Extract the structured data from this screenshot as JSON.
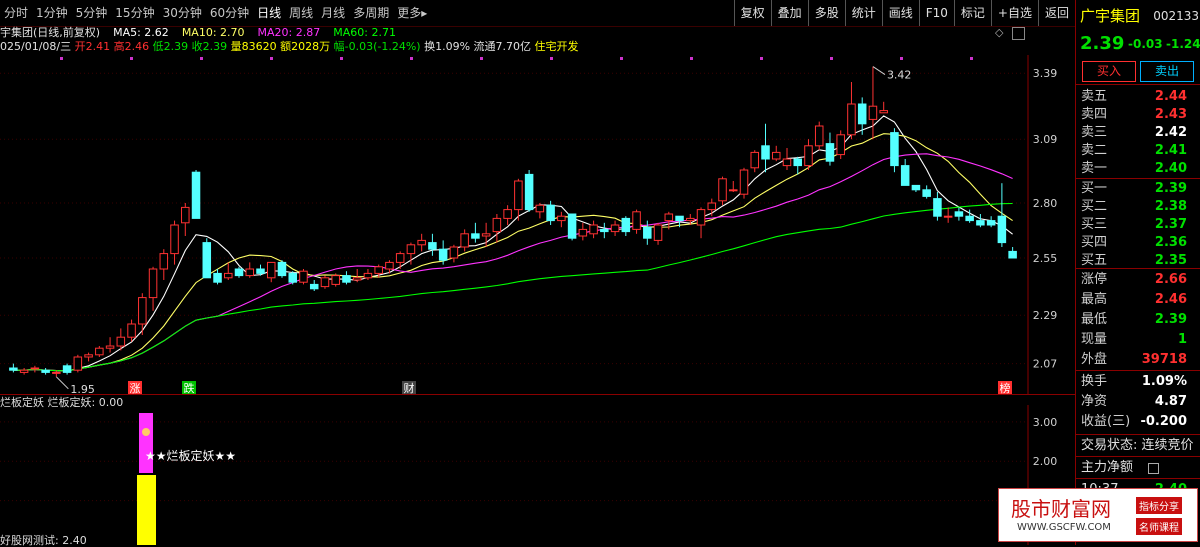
{
  "toolbar": {
    "periods": [
      "分时",
      "1分钟",
      "5分钟",
      "15分钟",
      "30分钟",
      "60分钟",
      "日线",
      "周线",
      "月线",
      "多周期",
      "更多▸"
    ],
    "active_period": "日线",
    "buttons": [
      "复权",
      "叠加",
      "多股",
      "统计",
      "画线",
      "F10",
      "标记",
      "+自选",
      "返回"
    ]
  },
  "info": {
    "stock_title": "宇集团(日线,前复权)",
    "ma5": "MA5: 2.62",
    "ma10": "MA10: 2.70",
    "ma20": "MA20: 2.87",
    "ma60": "MA60: 2.71",
    "date": "025/01/08/三",
    "open": "开2.41",
    "high": "高2.46",
    "low": "低2.39",
    "close": "收2.39",
    "volume": "量83620",
    "amount": "额2028万",
    "change": "幅-0.03(-1.24%)",
    "turnover": "换1.09%",
    "float": "流通7.70亿",
    "sector": "住宅开发"
  },
  "chart": {
    "y_ticks": [
      "3.39",
      "3.09",
      "2.80",
      "2.55",
      "2.29",
      "2.07"
    ],
    "high_label": "3.42",
    "low_label": "1.95",
    "markers": [
      "涨",
      "跌",
      "财",
      "榜"
    ],
    "colors": {
      "up": "#ff3232",
      "down": "#54ffff",
      "ma5": "#ffffff",
      "ma10": "#ffff66",
      "ma20": "#ff33ff",
      "ma60": "#00ff00"
    }
  },
  "chart_data": {
    "type": "candlestick",
    "title": "宇集团(日线,前复权)",
    "ylim": [
      1.95,
      3.45
    ],
    "candles_ohlc": [
      [
        2.05,
        2.07,
        2.03,
        2.04
      ],
      [
        2.03,
        2.05,
        2.02,
        2.04
      ],
      [
        2.05,
        2.06,
        2.03,
        2.05
      ],
      [
        2.04,
        2.05,
        2.02,
        2.03
      ],
      [
        2.03,
        2.04,
        2.01,
        2.03
      ],
      [
        2.06,
        2.07,
        2.02,
        2.03
      ],
      [
        2.04,
        2.11,
        2.03,
        2.1
      ],
      [
        2.1,
        2.12,
        2.08,
        2.11
      ],
      [
        2.11,
        2.15,
        2.1,
        2.14
      ],
      [
        2.14,
        2.19,
        2.12,
        2.15
      ],
      [
        2.15,
        2.23,
        2.13,
        2.19
      ],
      [
        2.19,
        2.27,
        2.17,
        2.25
      ],
      [
        2.25,
        2.39,
        2.2,
        2.37
      ],
      [
        2.37,
        2.51,
        2.31,
        2.5
      ],
      [
        2.5,
        2.59,
        2.45,
        2.57
      ],
      [
        2.57,
        2.72,
        2.52,
        2.7
      ],
      [
        2.71,
        2.8,
        2.65,
        2.78
      ],
      [
        2.94,
        2.95,
        2.73,
        2.73
      ],
      [
        2.62,
        2.64,
        2.46,
        2.46
      ],
      [
        2.48,
        2.5,
        2.43,
        2.44
      ],
      [
        2.46,
        2.53,
        2.45,
        2.48
      ],
      [
        2.5,
        2.51,
        2.46,
        2.47
      ],
      [
        2.47,
        2.53,
        2.46,
        2.5
      ],
      [
        2.5,
        2.52,
        2.47,
        2.48
      ],
      [
        2.46,
        2.53,
        2.44,
        2.53
      ],
      [
        2.53,
        2.54,
        2.46,
        2.47
      ],
      [
        2.48,
        2.49,
        2.43,
        2.44
      ],
      [
        2.44,
        2.5,
        2.43,
        2.49
      ],
      [
        2.43,
        2.45,
        2.4,
        2.41
      ],
      [
        2.42,
        2.47,
        2.41,
        2.46
      ],
      [
        2.43,
        2.48,
        2.42,
        2.47
      ],
      [
        2.47,
        2.49,
        2.43,
        2.44
      ],
      [
        2.45,
        2.5,
        2.44,
        2.46
      ],
      [
        2.46,
        2.5,
        2.45,
        2.48
      ],
      [
        2.48,
        2.52,
        2.46,
        2.51
      ],
      [
        2.5,
        2.54,
        2.48,
        2.53
      ],
      [
        2.53,
        2.58,
        2.5,
        2.57
      ],
      [
        2.57,
        2.62,
        2.52,
        2.61
      ],
      [
        2.61,
        2.66,
        2.58,
        2.63
      ],
      [
        2.62,
        2.66,
        2.56,
        2.59
      ],
      [
        2.59,
        2.63,
        2.52,
        2.54
      ],
      [
        2.55,
        2.61,
        2.53,
        2.6
      ],
      [
        2.6,
        2.68,
        2.58,
        2.66
      ],
      [
        2.66,
        2.71,
        2.62,
        2.64
      ],
      [
        2.65,
        2.71,
        2.6,
        2.66
      ],
      [
        2.67,
        2.75,
        2.62,
        2.73
      ],
      [
        2.73,
        2.79,
        2.7,
        2.77
      ],
      [
        2.77,
        2.91,
        2.72,
        2.9
      ],
      [
        2.93,
        2.95,
        2.76,
        2.77
      ],
      [
        2.76,
        2.8,
        2.73,
        2.79
      ],
      [
        2.79,
        2.81,
        2.7,
        2.72
      ],
      [
        2.72,
        2.76,
        2.69,
        2.74
      ],
      [
        2.75,
        2.75,
        2.63,
        2.64
      ],
      [
        2.65,
        2.71,
        2.63,
        2.68
      ],
      [
        2.66,
        2.72,
        2.64,
        2.7
      ],
      [
        2.68,
        2.71,
        2.64,
        2.67
      ],
      [
        2.67,
        2.72,
        2.65,
        2.7
      ],
      [
        2.73,
        2.74,
        2.65,
        2.67
      ],
      [
        2.68,
        2.77,
        2.66,
        2.76
      ],
      [
        2.69,
        2.72,
        2.61,
        2.64
      ],
      [
        2.63,
        2.71,
        2.61,
        2.7
      ],
      [
        2.72,
        2.76,
        2.68,
        2.75
      ],
      [
        2.74,
        2.74,
        2.69,
        2.72
      ],
      [
        2.72,
        2.75,
        2.7,
        2.73
      ],
      [
        2.7,
        2.78,
        2.64,
        2.77
      ],
      [
        2.77,
        2.82,
        2.74,
        2.8
      ],
      [
        2.81,
        2.92,
        2.79,
        2.91
      ],
      [
        2.86,
        2.9,
        2.85,
        2.86
      ],
      [
        2.84,
        2.96,
        2.82,
        2.95
      ],
      [
        2.96,
        3.04,
        2.94,
        3.03
      ],
      [
        3.06,
        3.16,
        2.94,
        3.0
      ],
      [
        3.0,
        3.06,
        2.99,
        3.03
      ],
      [
        2.97,
        3.05,
        2.95,
        3.0
      ],
      [
        3.0,
        3.01,
        2.93,
        2.97
      ],
      [
        2.97,
        3.09,
        2.95,
        3.06
      ],
      [
        3.06,
        3.17,
        3.04,
        3.15
      ],
      [
        3.07,
        3.12,
        2.97,
        2.99
      ],
      [
        3.02,
        3.13,
        3.0,
        3.11
      ],
      [
        3.11,
        3.35,
        3.09,
        3.25
      ],
      [
        3.25,
        3.28,
        3.11,
        3.16
      ],
      [
        3.18,
        3.42,
        3.09,
        3.24
      ],
      [
        3.21,
        3.26,
        3.21,
        3.22
      ],
      [
        3.12,
        3.14,
        2.94,
        2.97
      ],
      [
        2.97,
        3.0,
        2.88,
        2.88
      ],
      [
        2.88,
        2.88,
        2.85,
        2.86
      ],
      [
        2.86,
        2.88,
        2.82,
        2.83
      ],
      [
        2.82,
        2.85,
        2.72,
        2.74
      ],
      [
        2.74,
        2.78,
        2.71,
        2.74
      ],
      [
        2.76,
        2.78,
        2.72,
        2.74
      ],
      [
        2.74,
        2.77,
        2.71,
        2.72
      ],
      [
        2.72,
        2.75,
        2.69,
        2.7
      ],
      [
        2.72,
        2.74,
        2.69,
        2.7
      ],
      [
        2.74,
        2.89,
        2.6,
        2.62
      ],
      [
        2.58,
        2.6,
        2.55,
        2.55
      ]
    ]
  },
  "subchart": {
    "title": "烂板定妖",
    "value_label": "烂板定妖: 0.00",
    "y_ticks": [
      "3.00",
      "2.00",
      "1.00"
    ],
    "signal_text": "★★烂板定妖★★",
    "bottom_label": "好股网测试: 2.40"
  },
  "right_panel": {
    "stock_name": "广宇集团",
    "stock_code": "002133",
    "price": "2.39",
    "change": "-0.03",
    "change_pct": "-1.24%",
    "buy_btn": "买入",
    "sell_btn": "卖出",
    "asks": [
      {
        "label": "卖五",
        "price": "2.44"
      },
      {
        "label": "卖四",
        "price": "2.43"
      },
      {
        "label": "卖三",
        "price": "2.42"
      },
      {
        "label": "卖二",
        "price": "2.41"
      },
      {
        "label": "卖一",
        "price": "2.40"
      }
    ],
    "bids": [
      {
        "label": "买一",
        "price": "2.39"
      },
      {
        "label": "买二",
        "price": "2.38"
      },
      {
        "label": "买三",
        "price": "2.37"
      },
      {
        "label": "买四",
        "price": "2.36"
      },
      {
        "label": "买五",
        "price": "2.35"
      }
    ],
    "limit_up": {
      "label": "涨停",
      "value": "2.66"
    },
    "high": {
      "label": "最高",
      "value": "2.46"
    },
    "low": {
      "label": "最低",
      "value": "2.39"
    },
    "now_vol": {
      "label": "现量",
      "value": "1"
    },
    "outer": {
      "label": "外盘",
      "value": "39718"
    },
    "turnover": {
      "label": "换手",
      "value": "1.09%"
    },
    "net_asset": {
      "label": "净资",
      "value": "4.87"
    },
    "eps": {
      "label": "收益(三)",
      "value": "-0.200"
    },
    "trade_status": "交易状态: 连续竞价",
    "main_flow": "主力净额",
    "time": "10:37",
    "time_price": "2.40"
  },
  "watermark": {
    "text": "股市财富网",
    "url": "WWW.GSCFW.COM",
    "tag1": "指标分享",
    "tag2": "名师课程"
  }
}
